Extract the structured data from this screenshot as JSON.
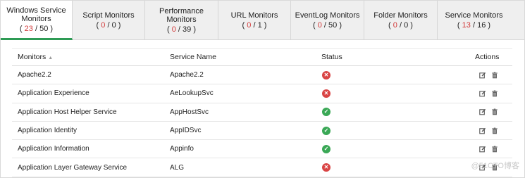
{
  "tabs": [
    {
      "label": "Windows Service Monitors",
      "active_count": "23",
      "total_count": "50",
      "active": true
    },
    {
      "label": "Script Monitors",
      "active_count": "0",
      "total_count": "0",
      "active": false
    },
    {
      "label": "Performance Monitors",
      "active_count": "0",
      "total_count": "39",
      "active": false
    },
    {
      "label": "URL Monitors",
      "active_count": "0",
      "total_count": "1",
      "active": false
    },
    {
      "label": "EventLog Monitors",
      "active_count": "0",
      "total_count": "50",
      "active": false
    },
    {
      "label": "Folder Monitors",
      "active_count": "0",
      "total_count": "0",
      "active": false
    },
    {
      "label": "Service Monitors",
      "active_count": "13",
      "total_count": "16",
      "active": false
    }
  ],
  "table": {
    "headers": {
      "monitors": "Monitors",
      "service_name": "Service Name",
      "status": "Status",
      "actions": "Actions"
    },
    "rows": [
      {
        "monitor": "Apache2.2",
        "service": "Apache2.2",
        "status": "down"
      },
      {
        "monitor": "Application Experience",
        "service": "AeLookupSvc",
        "status": "down"
      },
      {
        "monitor": "Application Host Helper Service",
        "service": "AppHostSvc",
        "status": "up"
      },
      {
        "monitor": "Application Identity",
        "service": "AppIDSvc",
        "status": "up"
      },
      {
        "monitor": "Application Information",
        "service": "Appinfo",
        "status": "up"
      },
      {
        "monitor": "Application Layer Gateway Service",
        "service": "ALG",
        "status": "down"
      }
    ]
  },
  "icons": {
    "status_down": "x-circle-icon",
    "status_up": "check-circle-icon",
    "edit": "edit-icon",
    "delete": "trash-icon"
  },
  "colors": {
    "active_tab_underline": "#2e9b55",
    "count_red": "#d23a3a",
    "status_down": "#d94444",
    "status_up": "#3aa856"
  },
  "watermark": "@51CTO博客"
}
